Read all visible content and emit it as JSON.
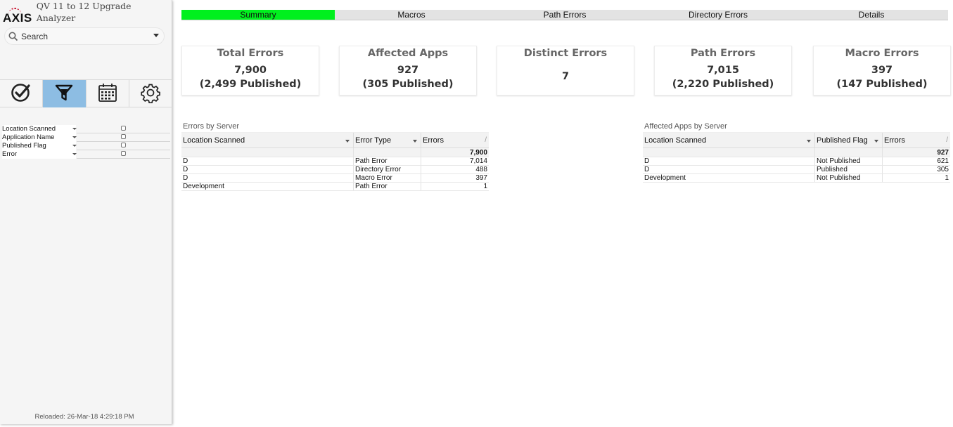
{
  "app": {
    "logo_text": "AXIS",
    "title": "QV 11 to 12 Upgrade Analyzer",
    "colors": {
      "accent_active_tab": "#00f01e",
      "toolbar_active": "#8dbde3",
      "logo_arc": "#c8102e"
    }
  },
  "search": {
    "placeholder": "Search",
    "icon": "search-icon"
  },
  "toolbar": {
    "items": [
      {
        "name": "selections",
        "icon": "checkmark-circle-icon",
        "active": false
      },
      {
        "name": "filters",
        "icon": "filter-funnel-icon",
        "active": true
      },
      {
        "name": "calendar",
        "icon": "calendar-icon",
        "active": false
      },
      {
        "name": "settings",
        "icon": "gear-icon",
        "active": false
      }
    ]
  },
  "filters": {
    "items": [
      {
        "label": "Location Scanned"
      },
      {
        "label": "Application Name"
      },
      {
        "label": "Published Flag"
      },
      {
        "label": "Error"
      }
    ]
  },
  "footer": {
    "reloaded": "Reloaded: 26-Mar-18 4:29:18 PM"
  },
  "tabs": {
    "items": [
      {
        "label": "Summary",
        "active": true
      },
      {
        "label": "Macros",
        "active": false
      },
      {
        "label": "Path Errors",
        "active": false
      },
      {
        "label": "Directory Errors",
        "active": false
      },
      {
        "label": "Details",
        "active": false
      }
    ]
  },
  "kpis": {
    "total": {
      "title": "Total Errors",
      "value": "7,900",
      "sub": "(2,499 Published)"
    },
    "affected": {
      "title": "Affected Apps",
      "value": "927",
      "sub": "(305 Published)"
    },
    "distinct": {
      "title": "Distinct Errors",
      "value": "7"
    },
    "path": {
      "title": "Path Errors",
      "value": "7,015",
      "sub": "(2,220 Published)"
    },
    "macro": {
      "title": "Macro Errors",
      "value": "397",
      "sub": "(147 Published)"
    }
  },
  "errors_by_server": {
    "title": "Errors by Server",
    "headers": [
      "Location Scanned",
      "Error Type",
      "Errors"
    ],
    "sort_icon": "/",
    "total": "7,900",
    "rows": [
      [
        "D",
        "Path Error",
        "7,014"
      ],
      [
        "D",
        "Directory Error",
        "488"
      ],
      [
        "D",
        "Macro Error",
        "397"
      ],
      [
        "Development",
        "Path Error",
        "1"
      ]
    ]
  },
  "apps_by_server": {
    "title": "Affected Apps by Server",
    "headers": [
      "Location Scanned",
      "Published Flag",
      "Errors"
    ],
    "sort_icon": "/",
    "total": "927",
    "rows": [
      [
        "D",
        "Not Published",
        "621"
      ],
      [
        "D",
        "Published",
        "305"
      ],
      [
        "Development",
        "Not Published",
        "1"
      ]
    ]
  }
}
